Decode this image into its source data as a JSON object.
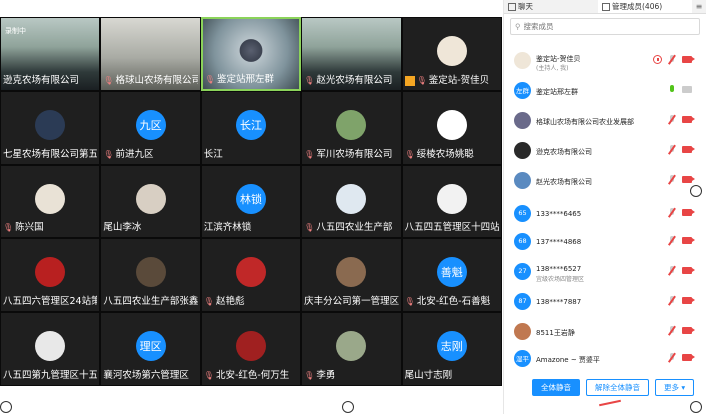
{
  "recording_label": "录制中",
  "tiles": [
    {
      "name": "逊克农场有限公司",
      "kind": "video",
      "scene": "classroom",
      "mic": false
    },
    {
      "name": "格球山农场有限公司...",
      "kind": "video",
      "scene": "room",
      "mic": true
    },
    {
      "name": "鉴定站邢左群",
      "kind": "video",
      "scene": "person",
      "mic": true,
      "active": true
    },
    {
      "name": "赵光农场有限公司",
      "kind": "video",
      "scene": "classroom",
      "mic": true
    },
    {
      "name": "鉴定站-贺佳贝",
      "kind": "avatar",
      "avatar_text": "",
      "avatar_color": "#efe6d8",
      "mic": true,
      "orange": true
    },
    {
      "name": "七星农场有限公司第五...",
      "kind": "avatar",
      "avatar_text": "",
      "avatar_color": "#2b3b55",
      "mic": false
    },
    {
      "name": "前进九区",
      "kind": "avatar",
      "avatar_text": "九区",
      "avatar_color": "#1890ff",
      "mic": true
    },
    {
      "name": "长江",
      "kind": "avatar",
      "avatar_text": "长江",
      "avatar_color": "#1890ff",
      "mic": false
    },
    {
      "name": "军川农场有限公司",
      "kind": "avatar",
      "avatar_text": "",
      "avatar_color": "#7fa36a",
      "mic": true
    },
    {
      "name": "绥棱农场姚聪",
      "kind": "avatar",
      "avatar_text": "",
      "avatar_color": "#ffffff",
      "mic": true
    },
    {
      "name": "陈兴国",
      "kind": "avatar",
      "avatar_text": "",
      "avatar_color": "#e9e2d6",
      "mic": true
    },
    {
      "name": "尾山李冰",
      "kind": "avatar",
      "avatar_text": "",
      "avatar_color": "#d8cfc3",
      "mic": false
    },
    {
      "name": "江滨齐林锁",
      "kind": "avatar",
      "avatar_text": "林锁",
      "avatar_color": "#1890ff",
      "mic": false
    },
    {
      "name": "八五四农业生产部",
      "kind": "avatar",
      "avatar_text": "",
      "avatar_color": "#dfe8f0",
      "mic": true
    },
    {
      "name": "八五四五管理区十四站...",
      "kind": "avatar",
      "avatar_text": "",
      "avatar_color": "#f2f2f2",
      "mic": false
    },
    {
      "name": "八五四六管理区24站策帅",
      "kind": "avatar",
      "avatar_text": "",
      "avatar_color": "#b82020",
      "mic": false
    },
    {
      "name": "八五四农业生产部张鑫",
      "kind": "avatar",
      "avatar_text": "",
      "avatar_color": "#5a4a3a",
      "mic": false
    },
    {
      "name": "赵艳彪",
      "kind": "avatar",
      "avatar_text": "",
      "avatar_color": "#c02828",
      "mic": true
    },
    {
      "name": "庆丰分公司第一管理区...",
      "kind": "avatar",
      "avatar_text": "",
      "avatar_color": "#8a6a50",
      "mic": false
    },
    {
      "name": "北安-红色-石善魁",
      "kind": "avatar",
      "avatar_text": "善魁",
      "avatar_color": "#1890ff",
      "mic": true
    },
    {
      "name": "八五四第九管理区十五...",
      "kind": "avatar",
      "avatar_text": "",
      "avatar_color": "#e8e8e8",
      "mic": false
    },
    {
      "name": "襄河农场第六管理区",
      "kind": "avatar",
      "avatar_text": "理区",
      "avatar_color": "#1890ff",
      "mic": false
    },
    {
      "name": "北安-红色-何万生",
      "kind": "avatar",
      "avatar_text": "",
      "avatar_color": "#a02020",
      "mic": true
    },
    {
      "name": "李勇",
      "kind": "avatar",
      "avatar_text": "",
      "avatar_color": "#9aa88a",
      "mic": true
    },
    {
      "name": "尾山寸志刚",
      "kind": "avatar",
      "avatar_text": "志刚",
      "avatar_color": "#1890ff",
      "mic": false
    }
  ],
  "panel": {
    "tab_chat": "聊天",
    "tab_members": "管理成员(406)",
    "search_placeholder": "搜索成员",
    "members": [
      {
        "name": "鉴定站-贺佳贝",
        "sub": "(主持人, 我)",
        "avatar_text": "",
        "avatar_color": "#efe6d8",
        "mic": "off",
        "hand": true
      },
      {
        "name": "鉴定站邢左群",
        "sub": "",
        "avatar_text": "左群",
        "avatar_color": "#1890ff",
        "mic": "on",
        "hand": false
      },
      {
        "name": "格球山农场有限公司农业发展部",
        "sub": "",
        "avatar_text": "",
        "avatar_color": "#6a6a8a",
        "mic": "off",
        "hand": false
      },
      {
        "name": "逊克农场有限公司",
        "sub": "",
        "avatar_text": "",
        "avatar_color": "#2a2a2a",
        "mic": "off",
        "hand": false
      },
      {
        "name": "赵光农场有限公司",
        "sub": "",
        "avatar_text": "",
        "avatar_color": "#5a8ac0",
        "mic": "off",
        "hand": false
      },
      {
        "name": "133****6465",
        "sub": "",
        "avatar_text": "65",
        "avatar_color": "#1890ff",
        "mic": "off",
        "hand": false
      },
      {
        "name": "137****4868",
        "sub": "",
        "avatar_text": "68",
        "avatar_color": "#1890ff",
        "mic": "off",
        "hand": false
      },
      {
        "name": "138****6527",
        "sub": "宜级农场四管理区",
        "avatar_text": "27",
        "avatar_color": "#1890ff",
        "mic": "off",
        "hand": false
      },
      {
        "name": "138****7887",
        "sub": "",
        "avatar_text": "87",
        "avatar_color": "#1890ff",
        "mic": "off",
        "hand": false
      },
      {
        "name": "8511王岩静",
        "sub": "",
        "avatar_text": "",
        "avatar_color": "#c07850",
        "mic": "off",
        "hand": false
      },
      {
        "name": "Amazone ~ 贾婆平",
        "sub": "",
        "avatar_text": "湿平",
        "avatar_color": "#1890ff",
        "mic": "off",
        "hand": false
      }
    ],
    "btn_mute_all": "全体静音",
    "btn_unmute_all": "解除全体静音",
    "btn_more": "更多 ▾"
  }
}
